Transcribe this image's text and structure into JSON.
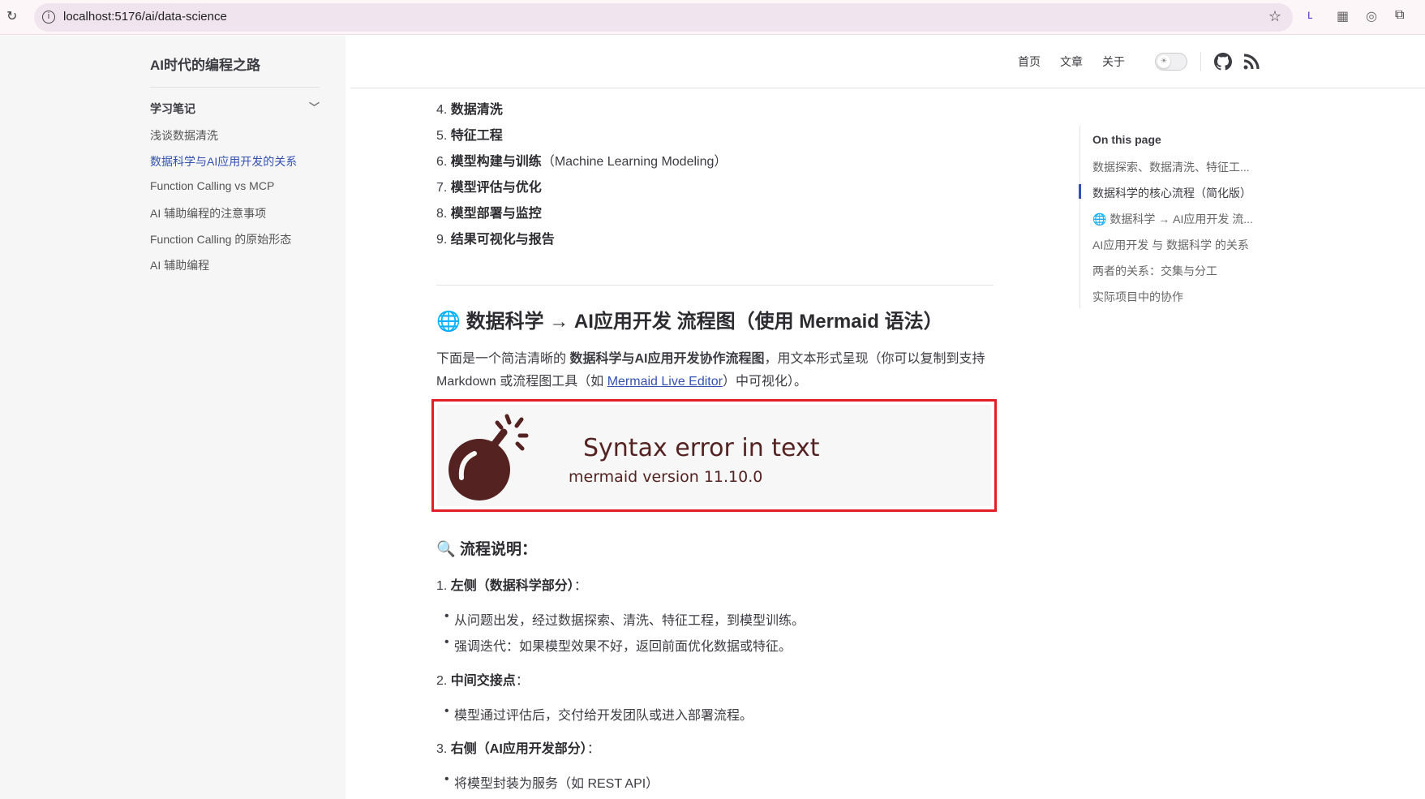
{
  "browser": {
    "url": "localhost:5176/ai/data-science"
  },
  "sidebar": {
    "title": "AI时代的编程之路",
    "section": "学习笔记",
    "items": [
      {
        "label": "浅谈数据清洗"
      },
      {
        "label": "数据科学与AI应用开发的关系"
      },
      {
        "label": "Function Calling vs MCP"
      },
      {
        "label": "AI 辅助编程的注意事项"
      },
      {
        "label": "Function Calling 的原始形态"
      },
      {
        "label": "AI 辅助编程"
      }
    ]
  },
  "nav": {
    "home": "首页",
    "articles": "文章",
    "about": "关于"
  },
  "content": {
    "steps": [
      {
        "num": "4.",
        "label": "数据清洗",
        "extra": ""
      },
      {
        "num": "5.",
        "label": "特征工程",
        "extra": ""
      },
      {
        "num": "6.",
        "label": "模型构建与训练",
        "extra": "（Machine Learning Modeling）"
      },
      {
        "num": "7.",
        "label": "模型评估与优化",
        "extra": ""
      },
      {
        "num": "8.",
        "label": "模型部署与监控",
        "extra": ""
      },
      {
        "num": "9.",
        "label": "结果可视化与报告",
        "extra": ""
      }
    ],
    "heading": "数据科学 → AI应用开发 流程图（使用 Mermaid 语法）",
    "para_a": "下面是一个简洁清晰的 ",
    "para_b": "数据科学与AI应用开发协作流程图",
    "para_c": "，用文本形式呈现（你可以复制到支持",
    "para2_a": "Markdown 或流程图工具（如 ",
    "para2_link": "Mermaid Live Editor",
    "para2_b": "）中可视化）。",
    "error_title": "Syntax error in text",
    "error_version": "mermaid version 11.10.0",
    "sub_heading": "流程说明：",
    "p1_num": "1.",
    "p1_label": "左侧（数据科学部分）",
    "p1_colon": "：",
    "p1_bullets": [
      "从问题出发，经过数据探索、清洗、特征工程，到模型训练。",
      "强调迭代：如果模型效果不好，返回前面优化数据或特征。"
    ],
    "p2_num": "2.",
    "p2_label": "中间交接点",
    "p2_colon": "：",
    "p2_bullets": [
      "模型通过评估后，交付给开发团队或进入部署流程。"
    ],
    "p3_num": "3.",
    "p3_label": "右侧（AI应用开发部分）",
    "p3_colon": "：",
    "p3_bullets": [
      "将模型封装为服务（如 REST API）"
    ]
  },
  "outline": {
    "title": "On this page",
    "items": [
      {
        "label": "数据探索、数据清洗、特征工..."
      },
      {
        "label": "数据科学的核心流程（简化版）"
      },
      {
        "label": "数据科学 → AI应用开发 流..."
      },
      {
        "label": "AI应用开发 与 数据科学 的关系"
      },
      {
        "label": "两者的关系：交集与分工"
      },
      {
        "label": "实际项目中的协作"
      }
    ]
  },
  "colors": {
    "accent": "#3451b2",
    "error_border": "#e01f26",
    "bomb": "#552222"
  }
}
